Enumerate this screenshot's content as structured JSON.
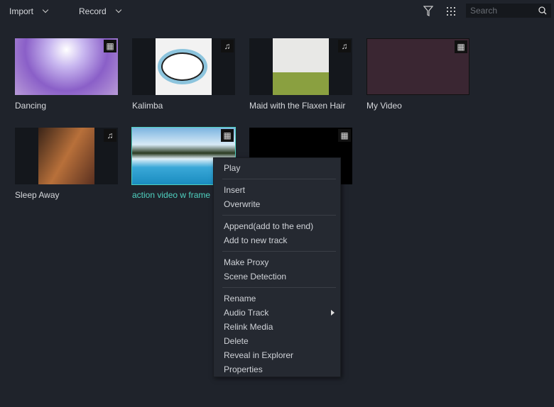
{
  "toolbar": {
    "import_label": "Import",
    "record_label": "Record",
    "search_placeholder": "Search"
  },
  "media": [
    {
      "name": "Dancing",
      "type": "video"
    },
    {
      "name": "Kalimba",
      "type": "audio"
    },
    {
      "name": "Maid with the Flaxen Hair",
      "type": "audio"
    },
    {
      "name": "My Video",
      "type": "video"
    },
    {
      "name": "Sleep Away",
      "type": "audio"
    },
    {
      "name": "action video w frame",
      "type": "video",
      "selected": true
    },
    {
      "name": "",
      "type": "video"
    }
  ],
  "context_menu": {
    "play": "Play",
    "insert": "Insert",
    "overwrite": "Overwrite",
    "append": "Append(add to the end)",
    "add_new_track": "Add to new track",
    "make_proxy": "Make Proxy",
    "scene_detection": "Scene Detection",
    "rename": "Rename",
    "audio_track": "Audio Track",
    "relink": "Relink Media",
    "delete": "Delete",
    "reveal": "Reveal in Explorer",
    "properties": "Properties"
  },
  "colors": {
    "accent": "#4fd1c0",
    "background": "#1f232b"
  }
}
